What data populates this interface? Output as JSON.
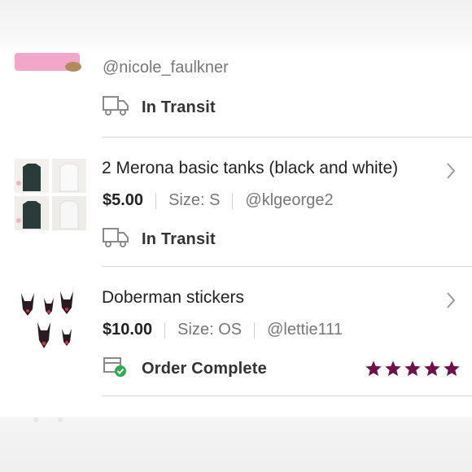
{
  "colors": {
    "star": "#6e1249",
    "complete_badge": "#34a853",
    "divider": "#d6d6d6"
  },
  "orders": [
    {
      "seller": "@nicole_faulkner",
      "status": "In Transit",
      "status_icon": "truck-icon"
    },
    {
      "title": "2 Merona basic tanks (black and white)",
      "price": "$5.00",
      "size": "Size: S",
      "seller": "@klgeorge2",
      "status": "In Transit",
      "status_icon": "truck-icon"
    },
    {
      "title": "Doberman stickers",
      "price": "$10.00",
      "size": "Size: OS",
      "seller": "@lettie111",
      "status": "Order Complete",
      "status_icon": "box-check-icon",
      "rating": 5
    }
  ]
}
